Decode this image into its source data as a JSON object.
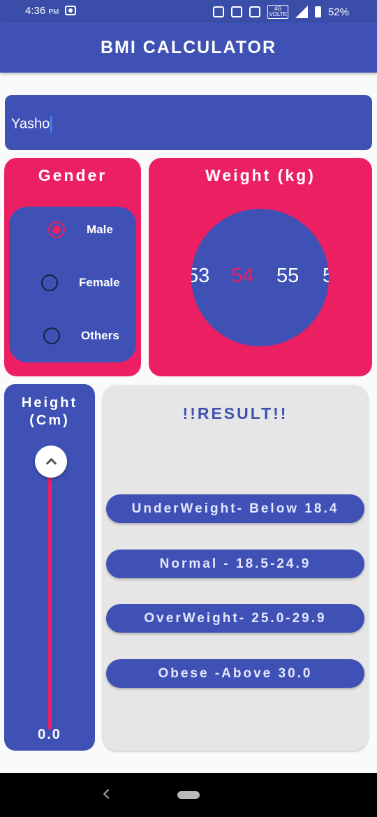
{
  "status_bar": {
    "time": "4:36",
    "ampm": "PM",
    "network": "4G",
    "network_sub": "VOLTE",
    "battery": "52%"
  },
  "app_bar": {
    "title": "BMI CALCULATOR"
  },
  "name_input": {
    "value": "Yasho"
  },
  "gender": {
    "title": "Gender",
    "options": [
      {
        "label": "Male",
        "checked": true
      },
      {
        "label": "Female",
        "checked": false
      },
      {
        "label": "Others",
        "checked": false
      }
    ]
  },
  "weight": {
    "title": "Weight (kg)",
    "values": [
      "53",
      "54",
      "55",
      "5"
    ],
    "selected": "54"
  },
  "height": {
    "title_line1": "Height",
    "title_line2": "(Cm)",
    "value": "0.0"
  },
  "result": {
    "title": "!!RESULT!!",
    "ranges": [
      "UnderWeight- Below 18.4",
      "Normal - 18.5-24.9",
      "OverWeight- 25.0-29.9",
      "Obese -Above 30.0"
    ]
  },
  "colors": {
    "primary": "#3f51b5",
    "accent": "#ec1f63",
    "result_bg": "#e6e6e6"
  }
}
